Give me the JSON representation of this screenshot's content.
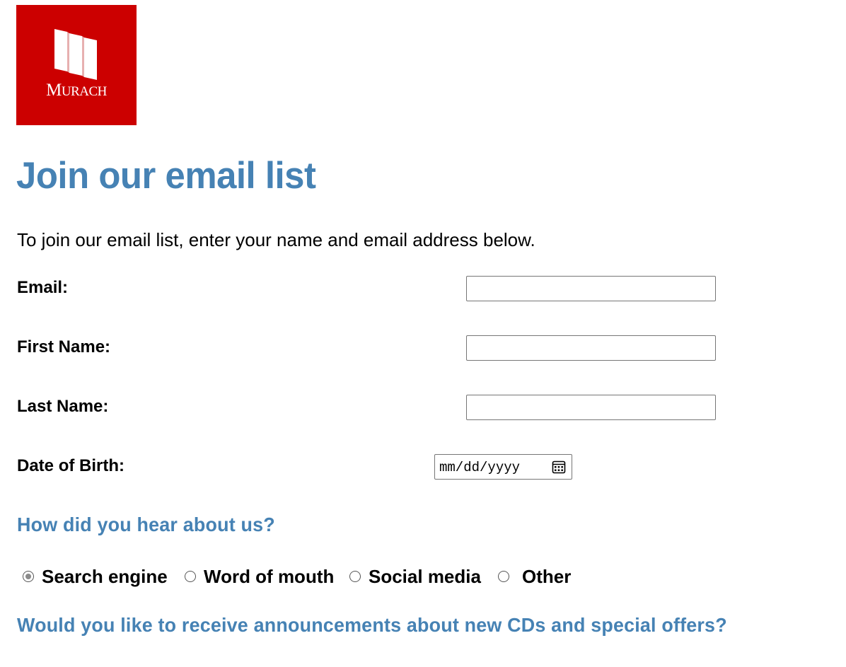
{
  "logo": {
    "text_big": "M",
    "text_small": "URACH"
  },
  "page_title": "Join our email list",
  "intro": "To join our email list, enter your name and email address below.",
  "fields": [
    {
      "label": "Email:",
      "value": ""
    },
    {
      "label": "First Name:",
      "value": ""
    },
    {
      "label": "Last Name:",
      "value": ""
    },
    {
      "label": "Date of Birth:",
      "placeholder": "mm/dd/yyyy"
    }
  ],
  "heard_heading": "How did you hear about us?",
  "heard_options": [
    {
      "label": "Search engine",
      "checked": true
    },
    {
      "label": "Word of mouth",
      "checked": false
    },
    {
      "label": "Social media",
      "checked": false
    },
    {
      "label": "Other",
      "checked": false
    }
  ],
  "announcements_heading": "Would you like to receive announcements about new CDs and special offers?",
  "colors": {
    "heading": "#4682b4",
    "logo_bg": "#cc0000"
  }
}
